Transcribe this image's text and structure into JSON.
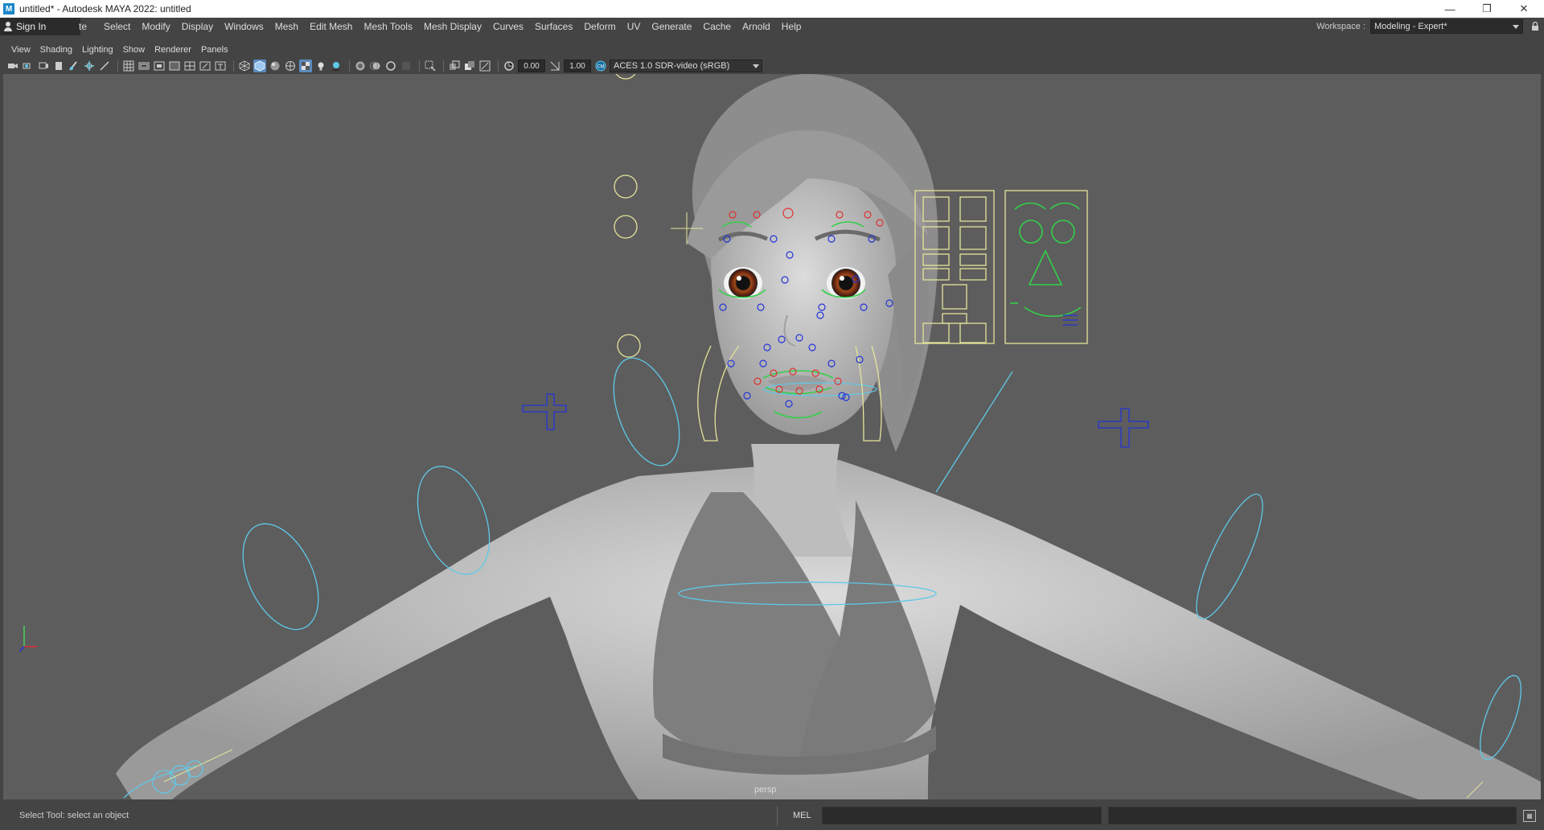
{
  "window": {
    "title": "untitled* - Autodesk MAYA 2022: untitled",
    "app_icon": "M"
  },
  "signin": {
    "label": "Sign In"
  },
  "menu": {
    "partial_item": "te",
    "items": [
      "Select",
      "Modify",
      "Display",
      "Windows",
      "Mesh",
      "Edit Mesh",
      "Mesh Tools",
      "Mesh Display",
      "Curves",
      "Surfaces",
      "Deform",
      "UV",
      "Generate",
      "Cache",
      "Arnold",
      "Help"
    ]
  },
  "workspace": {
    "label": "Workspace :",
    "value": "Modeling - Expert*"
  },
  "panel_menu": {
    "items": [
      "View",
      "Shading",
      "Lighting",
      "Show",
      "Renderer",
      "Panels"
    ]
  },
  "viewport_toolbar": {
    "exposure": "0.00",
    "gamma": "1.00",
    "color_space": "ACES 1.0 SDR-video (sRGB)"
  },
  "viewport": {
    "camera_label": "persp",
    "colors": {
      "background": "#5d5d5d",
      "control_blue": "#5fc8e8",
      "control_yellow": "#e4e49a",
      "face_green": "#33d04a",
      "face_red": "#e03030",
      "face_blue": "#2433d8"
    }
  },
  "statusline": {
    "help_text": "Select Tool: select an object",
    "mel_label": "MEL"
  }
}
